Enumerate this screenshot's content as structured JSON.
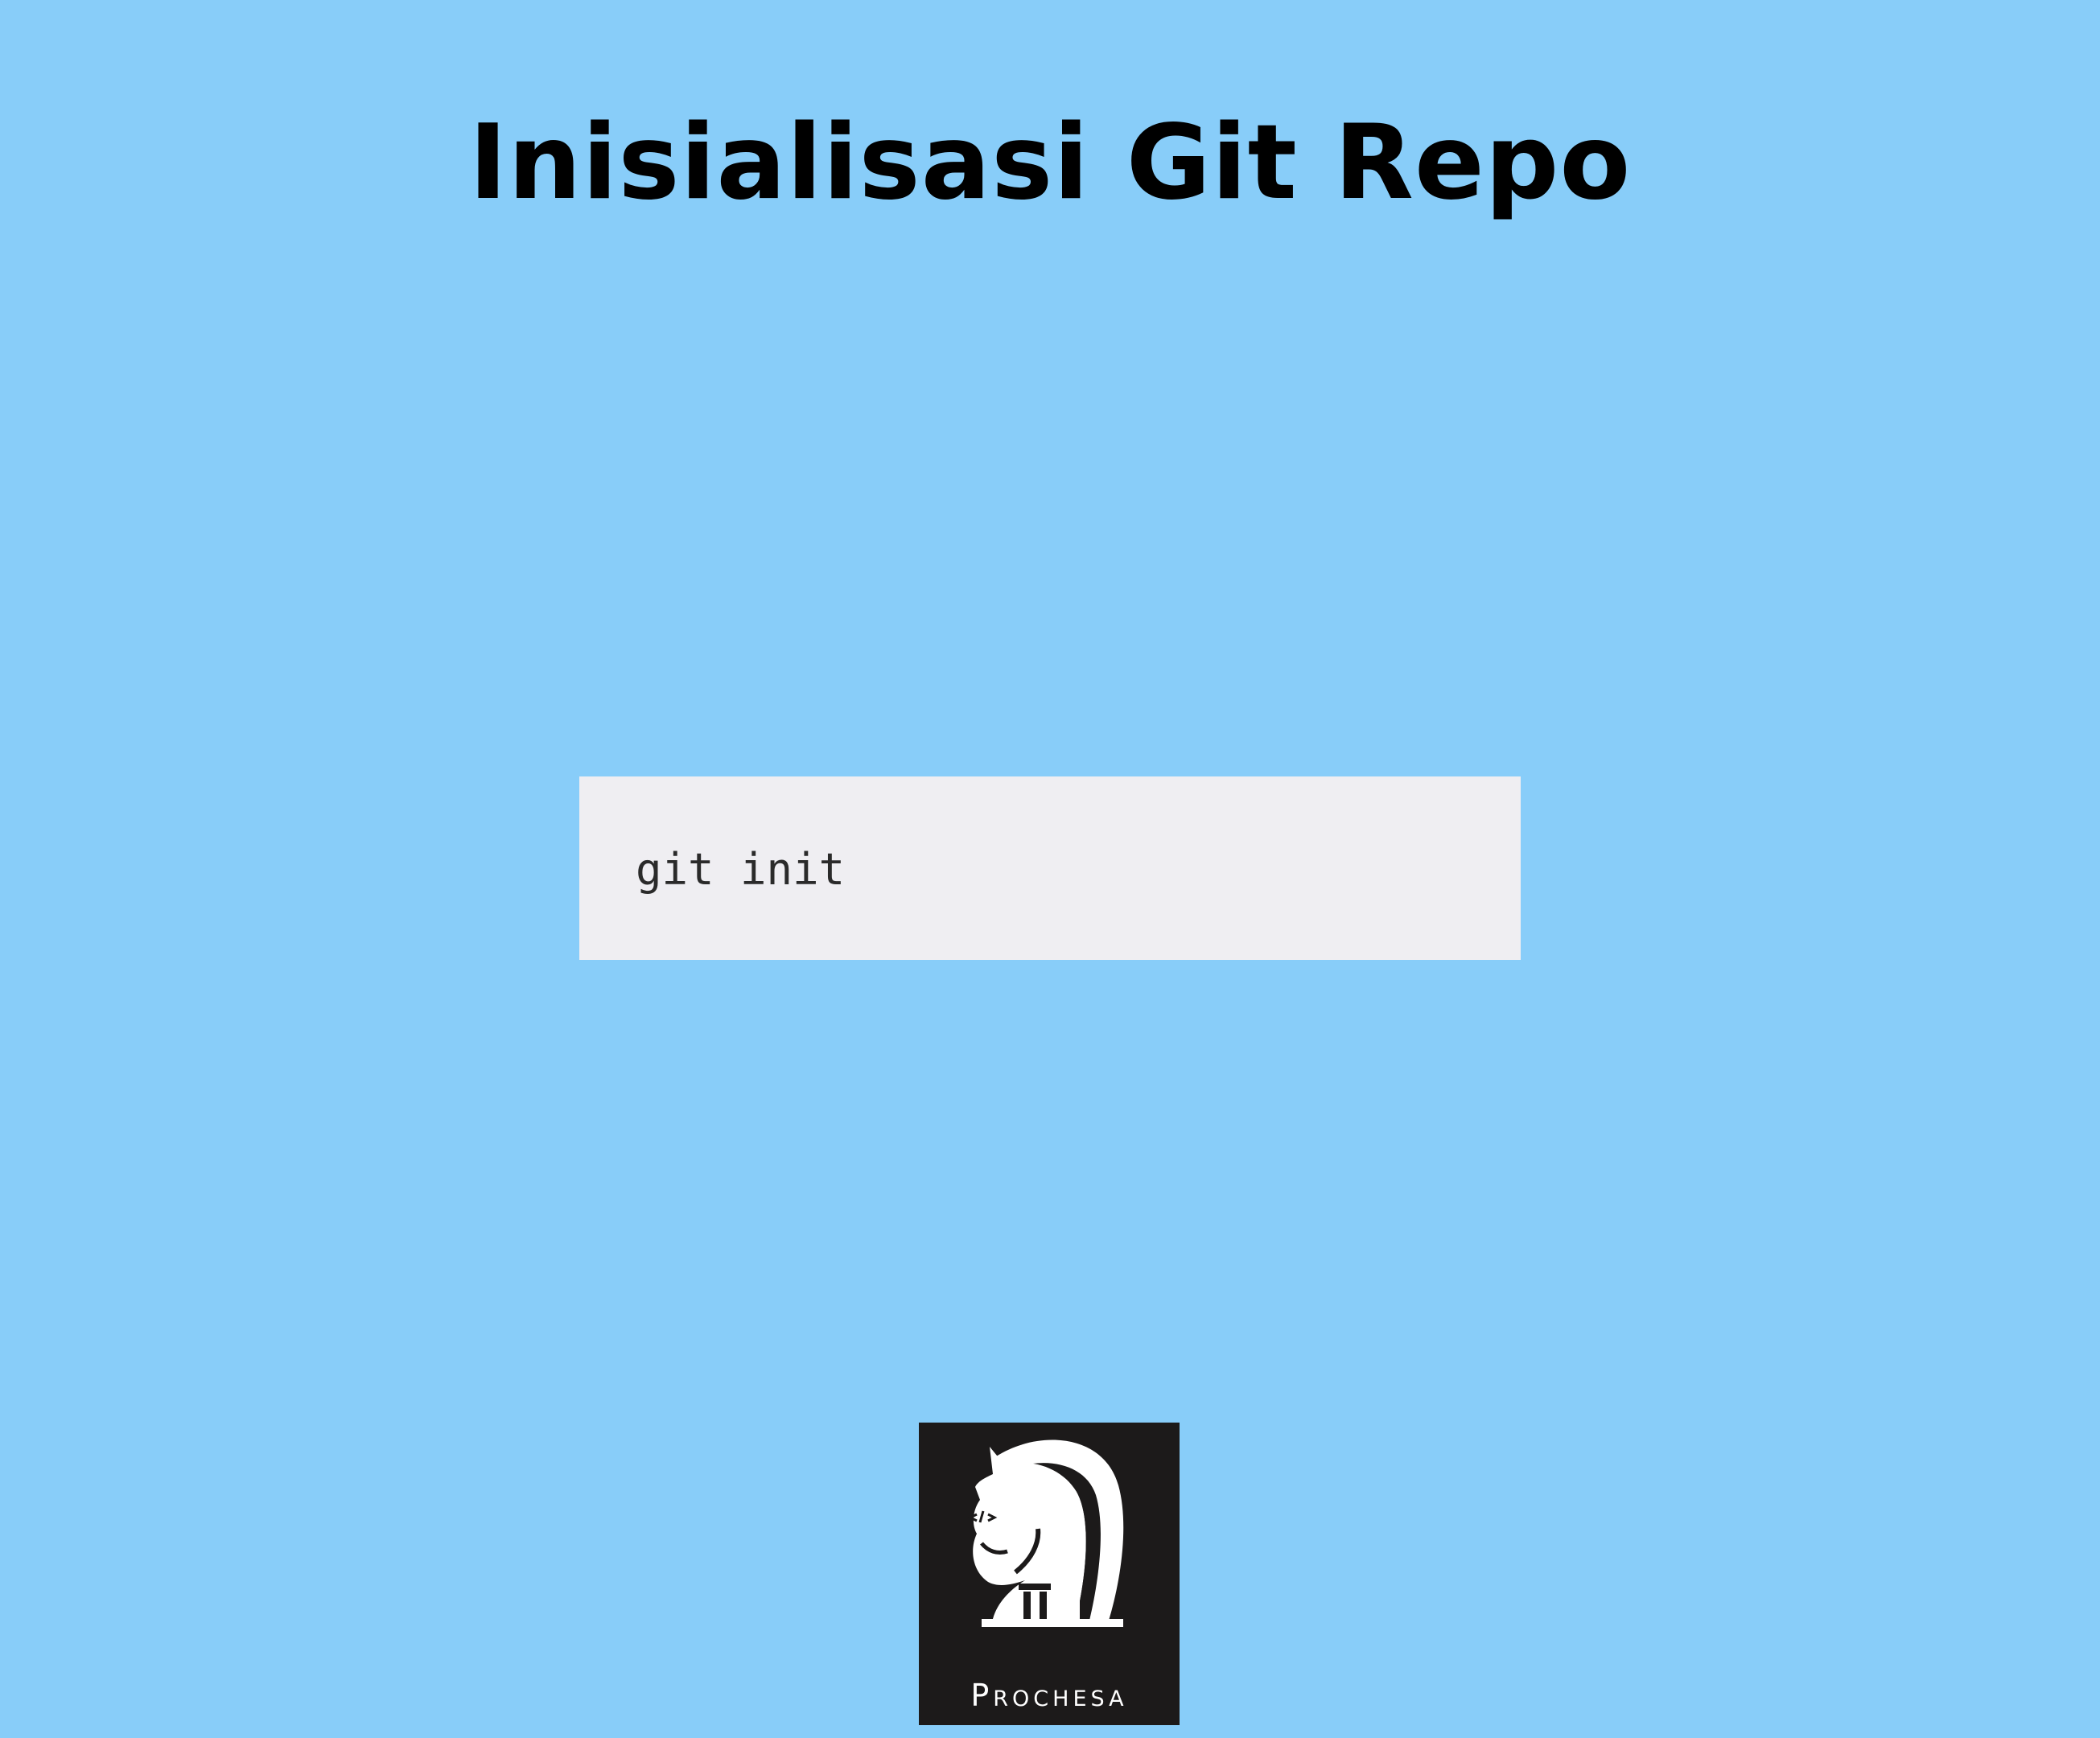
{
  "slide": {
    "title": "Inisialisasi Git Repo",
    "background_color": "#88cdf9"
  },
  "code_block": {
    "command": "git init",
    "background_color": "#efeef2"
  },
  "logo": {
    "icon": "knight-horse-icon",
    "code_symbol": "</>",
    "wordmark": "Prochesa",
    "background_color": "#1c1a1a"
  }
}
